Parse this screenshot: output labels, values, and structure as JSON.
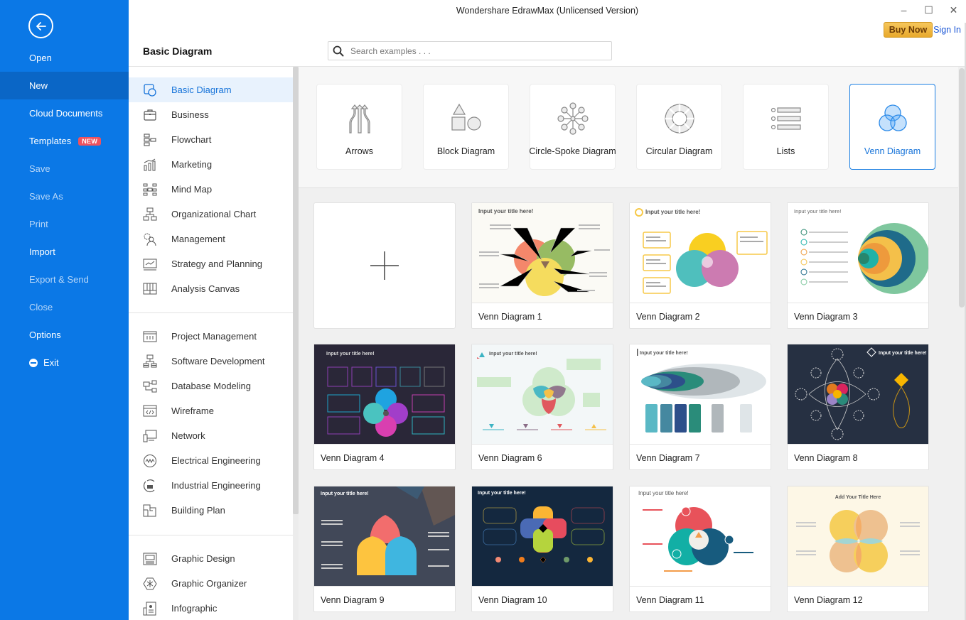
{
  "window": {
    "title": "Wondershare EdrawMax (Unlicensed Version)",
    "buy_now": "Buy Now",
    "sign_in": "Sign In",
    "minimize": "–",
    "maximize": "☐",
    "close": "✕"
  },
  "backstage": {
    "items": [
      {
        "label": "Open",
        "state": "enabled"
      },
      {
        "label": "New",
        "state": "active"
      },
      {
        "label": "Cloud Documents",
        "state": "enabled"
      },
      {
        "label": "Templates",
        "state": "enabled",
        "badge": "NEW"
      },
      {
        "label": "Save",
        "state": "disabled"
      },
      {
        "label": "Save As",
        "state": "disabled"
      },
      {
        "label": "Print",
        "state": "disabled"
      },
      {
        "label": "Import",
        "state": "enabled"
      },
      {
        "label": "Export & Send",
        "state": "disabled"
      },
      {
        "label": "Close",
        "state": "disabled"
      },
      {
        "label": "Options",
        "state": "enabled"
      },
      {
        "label": "Exit",
        "state": "enabled"
      }
    ]
  },
  "header": {
    "section_title": "Basic Diagram",
    "search_placeholder": "Search examples . . ."
  },
  "categories": {
    "group1": [
      {
        "label": "Basic Diagram",
        "icon": "basic-diagram-icon",
        "active": true
      },
      {
        "label": "Business",
        "icon": "briefcase-icon"
      },
      {
        "label": "Flowchart",
        "icon": "flowchart-icon"
      },
      {
        "label": "Marketing",
        "icon": "bar-chart-icon"
      },
      {
        "label": "Mind Map",
        "icon": "mind-map-icon"
      },
      {
        "label": "Organizational Chart",
        "icon": "org-chart-icon"
      },
      {
        "label": "Management",
        "icon": "management-icon"
      },
      {
        "label": "Strategy and Planning",
        "icon": "strategy-icon"
      },
      {
        "label": "Analysis Canvas",
        "icon": "analysis-canvas-icon"
      }
    ],
    "group2": [
      {
        "label": "Project Management",
        "icon": "project-management-icon"
      },
      {
        "label": "Software Development",
        "icon": "software-development-icon"
      },
      {
        "label": "Database Modeling",
        "icon": "database-modeling-icon"
      },
      {
        "label": "Wireframe",
        "icon": "wireframe-icon"
      },
      {
        "label": "Network",
        "icon": "network-icon"
      },
      {
        "label": "Electrical Engineering",
        "icon": "electrical-icon"
      },
      {
        "label": "Industrial Engineering",
        "icon": "industrial-icon"
      },
      {
        "label": "Building Plan",
        "icon": "building-plan-icon"
      }
    ],
    "group3": [
      {
        "label": "Graphic Design",
        "icon": "graphic-design-icon"
      },
      {
        "label": "Graphic Organizer",
        "icon": "graphic-organizer-icon"
      },
      {
        "label": "Infographic",
        "icon": "infographic-icon"
      }
    ]
  },
  "diagram_types": [
    {
      "label": "Arrows",
      "icon": "arrows-icon"
    },
    {
      "label": "Block Diagram",
      "icon": "block-diagram-icon"
    },
    {
      "label": "Circle-Spoke Diagram",
      "icon": "circle-spoke-icon"
    },
    {
      "label": "Circular Diagram",
      "icon": "circular-diagram-icon"
    },
    {
      "label": "Lists",
      "icon": "lists-icon"
    },
    {
      "label": "Venn Diagram",
      "icon": "venn-diagram-icon",
      "active": true
    }
  ],
  "templates": [
    {
      "name": "Venn Diagram 1",
      "thumb_title": "Input your title here!"
    },
    {
      "name": "Venn Diagram 2",
      "thumb_title": "Input your title here!"
    },
    {
      "name": "Venn Diagram 3",
      "thumb_title": "Input your title here!"
    },
    {
      "name": "Venn Diagram 4",
      "thumb_title": "Input your title here!"
    },
    {
      "name": "Venn Diagram 6",
      "thumb_title": "Input your title here!"
    },
    {
      "name": "Venn Diagram 7",
      "thumb_title": "Input your title here!"
    },
    {
      "name": "Venn Diagram 8",
      "thumb_title": "Input your title here!"
    },
    {
      "name": "Venn Diagram 9",
      "thumb_title": "Input your title here!"
    },
    {
      "name": "Venn Diagram 10",
      "thumb_title": "Input your title here!"
    },
    {
      "name": "Venn Diagram 11",
      "thumb_title": "Input your title here!"
    },
    {
      "name": "Venn Diagram 12",
      "thumb_title": "Add Your Title Here"
    }
  ],
  "colors": {
    "accent": "#0b78e6",
    "accent_dark": "#0a66c6",
    "selected_text": "#1673d9",
    "badge": "#f0525e",
    "buy_now": "#f0b840"
  }
}
